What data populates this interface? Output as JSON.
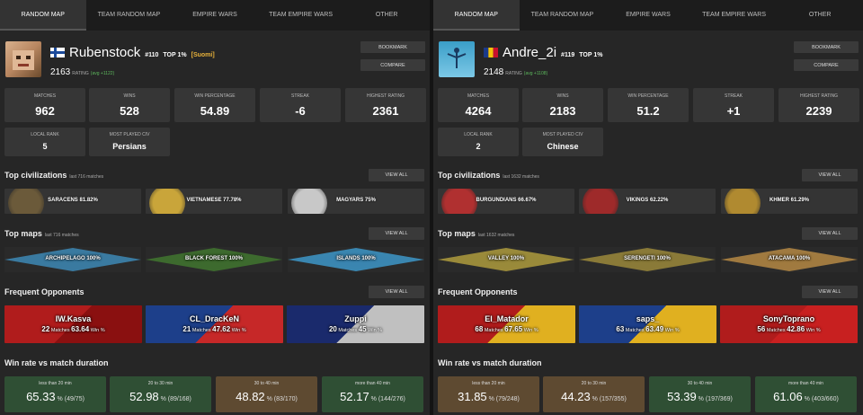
{
  "players": [
    {
      "tabs": [
        "RANDOM MAP",
        "TEAM RANDOM MAP",
        "EMPIRE WARS",
        "TEAM EMPIRE WARS",
        "OTHER"
      ],
      "active_tab": 0,
      "name": "Rubenstock",
      "rank": "#110",
      "top": "TOP 1%",
      "country": "[Suomi]",
      "flag": "finland-flag",
      "rating": "2163",
      "rating_label": "RATING",
      "rating_avg": "(avg +1122)",
      "bookmark": "BOOKMARK",
      "compare": "COMPARE",
      "stats": [
        {
          "label": "MATCHES",
          "value": "962"
        },
        {
          "label": "WINS",
          "value": "528"
        },
        {
          "label": "WIN PERCENTAGE",
          "value": "54.89"
        },
        {
          "label": "STREAK",
          "value": "-6"
        },
        {
          "label": "HIGHEST RATING",
          "value": "2361"
        }
      ],
      "stats2": [
        {
          "label": "LOCAL RANK",
          "value": "5"
        },
        {
          "label": "MOST PLAYED CIV",
          "value": "Persians"
        }
      ],
      "civ_title": "Top civilizations",
      "civ_sub": "last 716 matches",
      "civs": [
        {
          "name": "SARACENS",
          "pct": "81.82%",
          "color": "#6b5a3a"
        },
        {
          "name": "VIETNAMESE",
          "pct": "77.78%",
          "color": "#c9a53a"
        },
        {
          "name": "MAGYARS",
          "pct": "75%",
          "color": "#c8c8c8"
        }
      ],
      "maps_title": "Top maps",
      "maps_sub": "last 716 matches",
      "maps": [
        {
          "name": "ARCHIPELAGO",
          "pct": "100%",
          "color": "#3a7aa0"
        },
        {
          "name": "BLACK FOREST",
          "pct": "100%",
          "color": "#3d6a2e"
        },
        {
          "name": "ISLANDS",
          "pct": "100%",
          "color": "#3a86b0"
        }
      ],
      "opp_title": "Frequent Opponents",
      "opponents": [
        {
          "name": "IW.Kasva",
          "matches": "22",
          "pct": "63.64",
          "c1": "#b01c1c",
          "c2": "#8a1010"
        },
        {
          "name": "CL_DracKeN",
          "matches": "21",
          "pct": "47.62",
          "c1": "#1d3f8a",
          "c2": "#c62828"
        },
        {
          "name": "Zuppi",
          "matches": "20",
          "pct": "45",
          "c1": "#1a2a6c",
          "c2": "#c0c0c0"
        }
      ],
      "matches_word": "Matches",
      "win_word": "Win %",
      "wr_title": "Win rate vs match duration",
      "winrate": [
        {
          "label": "less than 20 min",
          "pct": "65.33",
          "ratio": "(49/75)",
          "tone": "green"
        },
        {
          "label": "20 to 30 min",
          "pct": "52.98",
          "ratio": "(89/168)",
          "tone": "green"
        },
        {
          "label": "30 to 40 min",
          "pct": "48.82",
          "ratio": "(83/170)",
          "tone": "brown"
        },
        {
          "label": "more than 40 min",
          "pct": "52.17",
          "ratio": "(144/276)",
          "tone": "green"
        }
      ],
      "view_all": "VIEW ALL"
    },
    {
      "tabs": [
        "RANDOM MAP",
        "TEAM RANDOM MAP",
        "EMPIRE WARS",
        "TEAM EMPIRE WARS",
        "OTHER"
      ],
      "active_tab": 0,
      "name": "Andre_2i",
      "rank": "#119",
      "top": "TOP 1%",
      "country": "",
      "flag": "romania-flag",
      "rating": "2148",
      "rating_label": "RATING",
      "rating_avg": "(avg +1108)",
      "bookmark": "BOOKMARK",
      "compare": "COMPARE",
      "stats": [
        {
          "label": "MATCHES",
          "value": "4264"
        },
        {
          "label": "WINS",
          "value": "2183"
        },
        {
          "label": "WIN PERCENTAGE",
          "value": "51.2"
        },
        {
          "label": "STREAK",
          "value": "+1"
        },
        {
          "label": "HIGHEST RATING",
          "value": "2239"
        }
      ],
      "stats2": [
        {
          "label": "LOCAL RANK",
          "value": "2"
        },
        {
          "label": "MOST PLAYED CIV",
          "value": "Chinese"
        }
      ],
      "civ_title": "Top civilizations",
      "civ_sub": "last 1632 matches",
      "civs": [
        {
          "name": "BURGUNDIANS",
          "pct": "66.67%",
          "color": "#b03030"
        },
        {
          "name": "VIKINGS",
          "pct": "62.22%",
          "color": "#9e2a2a"
        },
        {
          "name": "KHMER",
          "pct": "61.29%",
          "color": "#b08a30"
        }
      ],
      "maps_title": "Top maps",
      "maps_sub": "last 1632 matches",
      "maps": [
        {
          "name": "VALLEY",
          "pct": "100%",
          "color": "#9a8a3a"
        },
        {
          "name": "SERENGETI",
          "pct": "100%",
          "color": "#8a7a38"
        },
        {
          "name": "ATACAMA",
          "pct": "100%",
          "color": "#a07a40"
        }
      ],
      "opp_title": "Frequent Opponents",
      "opponents": [
        {
          "name": "El_Matador",
          "matches": "68",
          "pct": "67.65",
          "c1": "#b01c1c",
          "c2": "#e0b020"
        },
        {
          "name": "saps_",
          "matches": "63",
          "pct": "63.49",
          "c1": "#1d3f8a",
          "c2": "#e0b020"
        },
        {
          "name": "SonyToprano",
          "matches": "56",
          "pct": "42.86",
          "c1": "#b01c1c",
          "c2": "#c82020"
        }
      ],
      "matches_word": "Matches",
      "win_word": "Win %",
      "wr_title": "Win rate vs match duration",
      "winrate": [
        {
          "label": "less than 20 min",
          "pct": "31.85",
          "ratio": "(79/248)",
          "tone": "brown"
        },
        {
          "label": "20 to 30 min",
          "pct": "44.23",
          "ratio": "(157/355)",
          "tone": "brown"
        },
        {
          "label": "30 to 40 min",
          "pct": "53.39",
          "ratio": "(197/369)",
          "tone": "green"
        },
        {
          "label": "more than 40 min",
          "pct": "61.06",
          "ratio": "(403/660)",
          "tone": "green"
        }
      ],
      "view_all": "VIEW ALL"
    }
  ]
}
